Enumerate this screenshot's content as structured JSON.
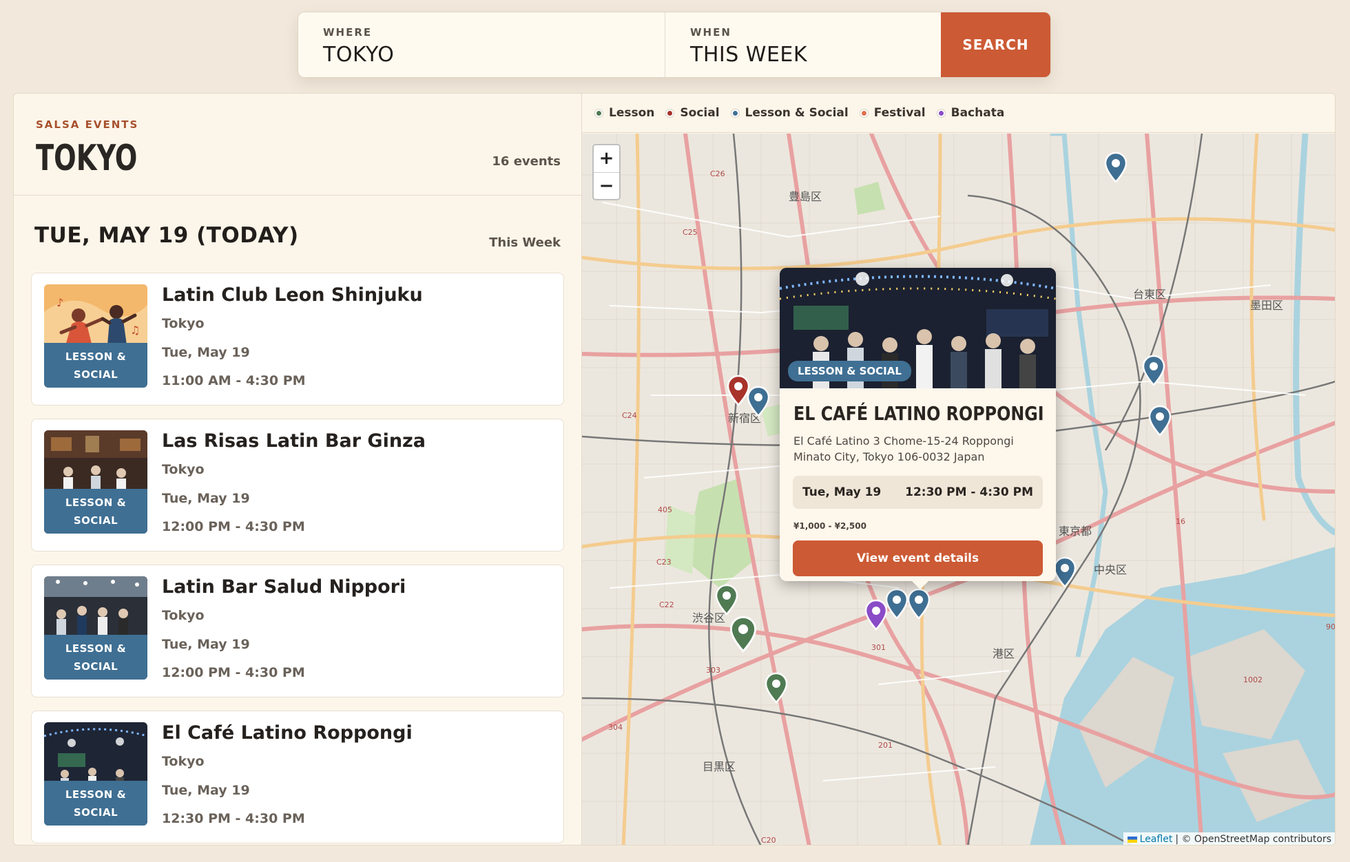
{
  "search": {
    "where_label": "WHERE",
    "where_value": "TOKYO",
    "when_label": "WHEN",
    "when_value": "THIS WEEK",
    "button_label": "SEARCH"
  },
  "header": {
    "kicker": "SALSA EVENTS",
    "city": "TOKYO",
    "count": "16 events"
  },
  "day": {
    "title": "TUE, MAY 19 (TODAY)",
    "tag": "This Week"
  },
  "events": [
    {
      "name": "Latin Club Leon Shinjuku",
      "city": "Tokyo",
      "date": "Tue, May 19",
      "time": "11:00 AM - 4:30 PM",
      "badge_line1": "LESSON &",
      "badge_line2": "SOCIAL"
    },
    {
      "name": "Las Risas Latin Bar Ginza",
      "city": "Tokyo",
      "date": "Tue, May 19",
      "time": "12:00 PM - 4:30 PM",
      "badge_line1": "LESSON &",
      "badge_line2": "SOCIAL"
    },
    {
      "name": "Latin Bar Salud Nippori",
      "city": "Tokyo",
      "date": "Tue, May 19",
      "time": "12:00 PM - 4:30 PM",
      "badge_line1": "LESSON &",
      "badge_line2": "SOCIAL"
    },
    {
      "name": "El Café Latino Roppongi",
      "city": "Tokyo",
      "date": "Tue, May 19",
      "time": "12:30 PM - 4:30 PM",
      "badge_line1": "LESSON &",
      "badge_line2": "SOCIAL"
    }
  ],
  "legend": [
    {
      "label": "Lesson",
      "color": "#4f7a52"
    },
    {
      "label": "Social",
      "color": "#a8332a"
    },
    {
      "label": "Lesson & Social",
      "color": "#3f6f93"
    },
    {
      "label": "Festival",
      "color": "#e0704a"
    },
    {
      "label": "Bachata",
      "color": "#8a4cc7"
    }
  ],
  "map": {
    "zoom_in": "+",
    "zoom_out": "−",
    "districts": [
      "豊島区",
      "台東区",
      "墨田区",
      "新宿区",
      "東京都",
      "中央区",
      "渋谷区",
      "港区",
      "目黒区"
    ],
    "attribution_link": "Leaflet",
    "attribution_text": "| © OpenStreetMap contributors"
  },
  "popup": {
    "badge": "LESSON & SOCIAL",
    "title": "EL CAFÉ LATINO ROPPONGI",
    "address_line1": "El Café Latino 3 Chome-15-24 Roppongi",
    "address_line2": "Minato City, Tokyo 106-0032 Japan",
    "date": "Tue, May 19",
    "time": "12:30 PM - 4:30 PM",
    "price": "¥1,000 - ¥2,500",
    "cta": "View event details"
  }
}
